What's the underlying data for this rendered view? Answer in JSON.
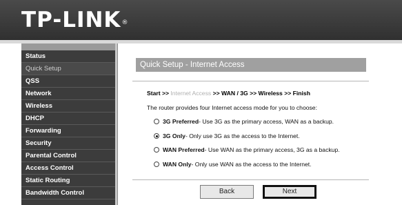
{
  "header": {
    "logo_text": "TP-LINK",
    "logo_mark": "®"
  },
  "sidebar": {
    "items": [
      {
        "label": "Status"
      },
      {
        "label": "Quick Setup"
      },
      {
        "label": "QSS"
      },
      {
        "label": "Network"
      },
      {
        "label": "Wireless"
      },
      {
        "label": "DHCP"
      },
      {
        "label": "Forwarding"
      },
      {
        "label": "Security"
      },
      {
        "label": "Parental Control"
      },
      {
        "label": "Access Control"
      },
      {
        "label": "Static Routing"
      },
      {
        "label": "Bandwidth Control"
      }
    ]
  },
  "main": {
    "title": "Quick Setup - Internet Access",
    "steps": {
      "start": "Start",
      "sep": ">>",
      "current": "Internet Access",
      "wan": "WAN / 3G",
      "wireless": "Wireless",
      "finish": "Finish"
    },
    "intro": "The router provides four Internet access mode for you to choose:",
    "options": [
      {
        "name": "3G Preferred",
        "desc": " - Use 3G as the primary access, WAN as a backup.",
        "checked": false
      },
      {
        "name": "3G Only",
        "desc": " - Only use 3G as the access to the Internet.",
        "checked": true
      },
      {
        "name": "WAN Preferred",
        "desc": " - Use WAN as the primary access, 3G as a backup.",
        "checked": false
      },
      {
        "name": "WAN Only",
        "desc": " - Only use WAN as the access to the Internet.",
        "checked": false
      }
    ],
    "back_label": "Back",
    "next_label": "Next"
  }
}
